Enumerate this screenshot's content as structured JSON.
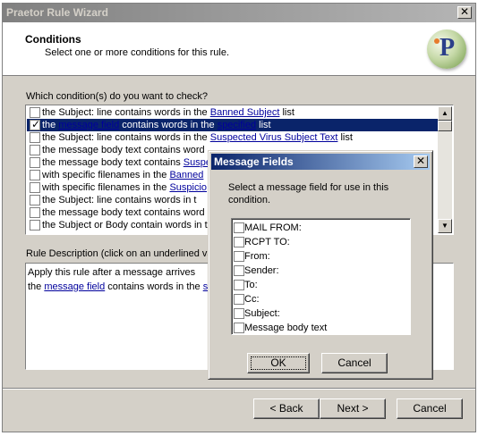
{
  "window": {
    "title": "Praetor Rule Wizard"
  },
  "header": {
    "title": "Conditions",
    "subtitle": "Select one or more conditions for this rule."
  },
  "question": "Which condition(s) do you want to check?",
  "conditions": [
    {
      "pre": "the Subject: line contains words in the ",
      "link": "Banned Subject",
      "post": " list",
      "checked": false,
      "selected": false
    },
    {
      "pre": "the ",
      "link": "message field",
      "mid": " contains words in the ",
      "link2": "specified",
      "post": " list",
      "checked": true,
      "selected": true
    },
    {
      "pre": "the Subject: line contains words in the ",
      "link": "Suspected Virus Subject Text",
      "post": " list",
      "checked": false,
      "selected": false
    },
    {
      "pre": "the message body text contains word",
      "link": "",
      "post": "",
      "checked": false,
      "selected": false
    },
    {
      "pre": "the message body text contains ",
      "link": "Suspe",
      "post": "",
      "checked": false,
      "selected": false
    },
    {
      "pre": "with specific filenames in the ",
      "link": "Banned",
      "post": "",
      "checked": false,
      "selected": false
    },
    {
      "pre": "with specific filenames in the ",
      "link": "Suspicio",
      "post": "",
      "checked": false,
      "selected": false
    },
    {
      "pre": "the Subject: line contains words in t",
      "link": "",
      "post": "",
      "checked": false,
      "selected": false
    },
    {
      "pre": "the message body text contains word",
      "link": "",
      "post": "",
      "checked": false,
      "selected": false
    },
    {
      "pre": "the Subject or Body contain words in t",
      "link": "",
      "post": "",
      "checked": false,
      "selected": false
    }
  ],
  "description": {
    "label": "Rule Description (click on an underlined va",
    "line1": "Apply this rule after a message arrives",
    "line2_pre": "the ",
    "line2_link": "message field",
    "line2_mid": " contains words in the ",
    "line2_link2": "s"
  },
  "buttons": {
    "back": "< Back",
    "next": "Next >",
    "cancel": "Cancel"
  },
  "dialog": {
    "title": "Message Fields",
    "instruction": "Select a message field for use in this condition.",
    "fields": [
      "MAIL FROM:",
      "RCPT TO:",
      "From:",
      "Sender:",
      "To:",
      "Cc:",
      "Subject:",
      "Message body text"
    ],
    "ok": "OK",
    "cancel": "Cancel"
  },
  "icons": {
    "close": "close-icon",
    "logo": "praetor-logo-icon",
    "scroll_up": "scroll-up-icon",
    "scroll_down": "scroll-down-icon"
  }
}
